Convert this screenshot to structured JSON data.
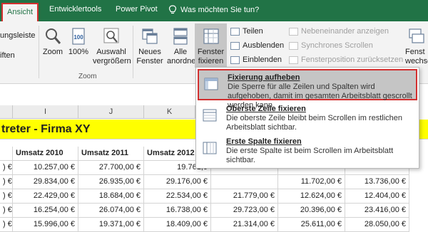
{
  "tabs": [
    {
      "label": "Ansicht",
      "active": true
    },
    {
      "label": "Entwicklertools"
    },
    {
      "label": "Power Pivot"
    },
    {
      "label": "Was möchten Sie tun?"
    }
  ],
  "ribbon": {
    "partial_left_1": "ungsleiste",
    "partial_left_2": "iften",
    "zoom": {
      "zoom_label": "Zoom",
      "hundred_label": "100%",
      "selection_label_1": "Auswahl",
      "selection_label_2": "vergrößern",
      "group_label": "Zoom"
    },
    "window": {
      "new_label_1": "Neues",
      "new_label_2": "Fenster",
      "arrange_label_1": "Alle",
      "arrange_label_2": "anordnen",
      "freeze_label_1": "Fenster",
      "freeze_label_2": "fixieren",
      "split_label": "Teilen",
      "hide_label": "Ausblenden",
      "unhide_label": "Einblenden",
      "side_by_side_label": "Nebeneinander anzeigen",
      "sync_scroll_label": "Synchrones Scrollen",
      "reset_position_label": "Fensterposition zurücksetzen",
      "partial_right": "Fenst",
      "partial_right_2": "wechse"
    }
  },
  "freeze_menu": [
    {
      "title": "Fixierung aufheben",
      "desc": "Die Sperre für alle Zeilen und Spalten wird aufgehoben, damit im gesamten Arbeitsblatt gescrollt werden kann.",
      "highlighted": true
    },
    {
      "title": "Oberste Zeile fixieren",
      "desc": "Die oberste Zeile bleibt beim Scrollen im restlichen Arbeitsblatt sichtbar."
    },
    {
      "title": "Erste Spalte fixieren",
      "desc": "Die erste Spalte ist beim Scrollen im Arbeitsblatt sichtbar."
    }
  ],
  "sheet": {
    "column_headers": [
      "I",
      "J",
      "K"
    ],
    "title": "treter - Firma XY",
    "headers": [
      "Umsatz 2010",
      "Umsatz 2011",
      "Umsatz 2012"
    ],
    "rows": [
      [
        ") €",
        "10.257,00 €",
        "27.700,00 €",
        "19.761,0",
        "",
        "",
        ""
      ],
      [
        ") €",
        "29.834,00 €",
        "26.935,00 €",
        "29.176,00 €",
        "",
        "11.702,00 €",
        "13.736,00 €"
      ],
      [
        ") €",
        "22.429,00 €",
        "18.684,00 €",
        "22.534,00 €",
        "21.779,00 €",
        "12.624,00 €",
        "12.404,00 €"
      ],
      [
        ") €",
        "16.254,00 €",
        "26.074,00 €",
        "16.738,00 €",
        "29.723,00 €",
        "20.396,00 €",
        "23.416,00 €"
      ],
      [
        ") €",
        "15.996,00 €",
        "19.371,00 €",
        "18.409,00 €",
        "21.314,00 €",
        "25.611,00 €",
        "28.050,00 €"
      ]
    ]
  },
  "colors": {
    "excel_green": "#217346",
    "highlight_red": "#d32f2f",
    "title_yellow": "#ffff00"
  }
}
